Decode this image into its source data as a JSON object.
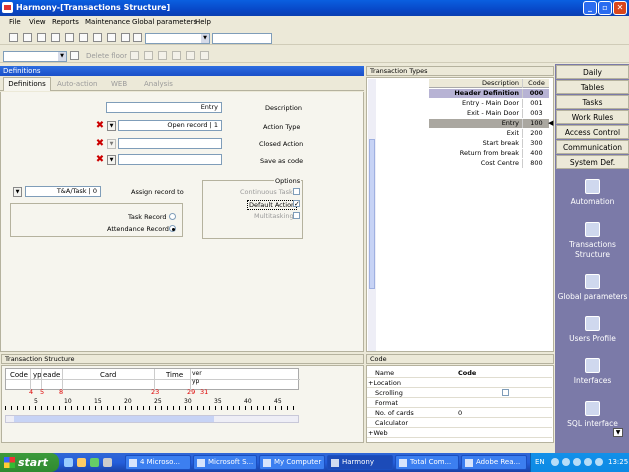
{
  "window": {
    "title": "Harmony-[Transactions Structure]"
  },
  "menu": [
    "File",
    "View",
    "Reports",
    "Maintenance",
    "Global parameters",
    "Help"
  ],
  "toolbar2": {
    "delete_floor": "Delete floor"
  },
  "definitions": {
    "header": "Definitions",
    "tabs": [
      "Definitions",
      "Auto-action",
      "WEB",
      "Analysis"
    ],
    "description_value": "Entry",
    "description_label": "Description",
    "action_type_value": "Open record  |  1",
    "action_type_label": "Action Type",
    "closed_action_label": "Closed Action",
    "save_as_code_label": "Save as code",
    "assign_value": "T&A/Task  |  0",
    "assign_label": "Assign record to",
    "task_record": "Task Record",
    "attendance_record": "Attendance Record",
    "options_title": "Options",
    "continuous_task": "Continuous Task",
    "default_action": "Default Action",
    "multitasking": "Multitasking"
  },
  "transaction_types": {
    "header": "Transaction Types",
    "col_description": "Description",
    "col_code": "Code",
    "rows": [
      {
        "description": "Header Definition",
        "code": "000"
      },
      {
        "description": "Entry - Main Door",
        "code": "001"
      },
      {
        "description": "Exit - Main Door",
        "code": "003"
      },
      {
        "description": "Entry",
        "code": "100"
      },
      {
        "description": "Exit",
        "code": "200"
      },
      {
        "description": "Start break",
        "code": "300"
      },
      {
        "description": "Return from break",
        "code": "400"
      },
      {
        "description": "Cost Centre",
        "code": "800"
      }
    ]
  },
  "nav": {
    "buttons": [
      "Daily",
      "Tables",
      "Tasks",
      "Work Rules",
      "Access Control",
      "Communication",
      "System Def."
    ],
    "icons": [
      {
        "label": "Automation",
        "icon": "automation-icon"
      },
      {
        "label": "Transactions Structure",
        "icon": "transactions-icon"
      },
      {
        "label": "Global parameters",
        "icon": "globe-icon"
      },
      {
        "label": "Users Profile",
        "icon": "users-icon"
      },
      {
        "label": "Interfaces",
        "icon": "interfaces-icon"
      },
      {
        "label": "SQL interface",
        "icon": "sql-icon"
      }
    ]
  },
  "transaction_structure": {
    "header": "Transaction Structure",
    "columns": [
      "Code",
      "yp",
      "eade",
      "Card",
      "Time",
      "ver yp"
    ],
    "positions": [
      "4",
      "5",
      "8",
      "23",
      "29",
      "31"
    ],
    "ruler": [
      "5",
      "10",
      "15",
      "20",
      "25",
      "30",
      "35",
      "40",
      "45"
    ]
  },
  "code_panel": {
    "header": "Code",
    "rows": [
      {
        "key": "Name",
        "value": "Code"
      },
      {
        "key": "+Location",
        "value": ""
      },
      {
        "key": "Scrolling",
        "value": ""
      },
      {
        "key": "Format",
        "value": ""
      },
      {
        "key": "No. of cards",
        "value": "0"
      },
      {
        "key": "Calculator",
        "value": ""
      },
      {
        "key": "+Web",
        "value": ""
      }
    ]
  },
  "taskbar": {
    "start": "start",
    "tasks": [
      "4 Microso...",
      "Microsoft S...",
      "My Computer",
      "Harmony",
      "Total Com...",
      "Adobe Rea..."
    ],
    "lang": "EN",
    "clock": "13:25"
  }
}
